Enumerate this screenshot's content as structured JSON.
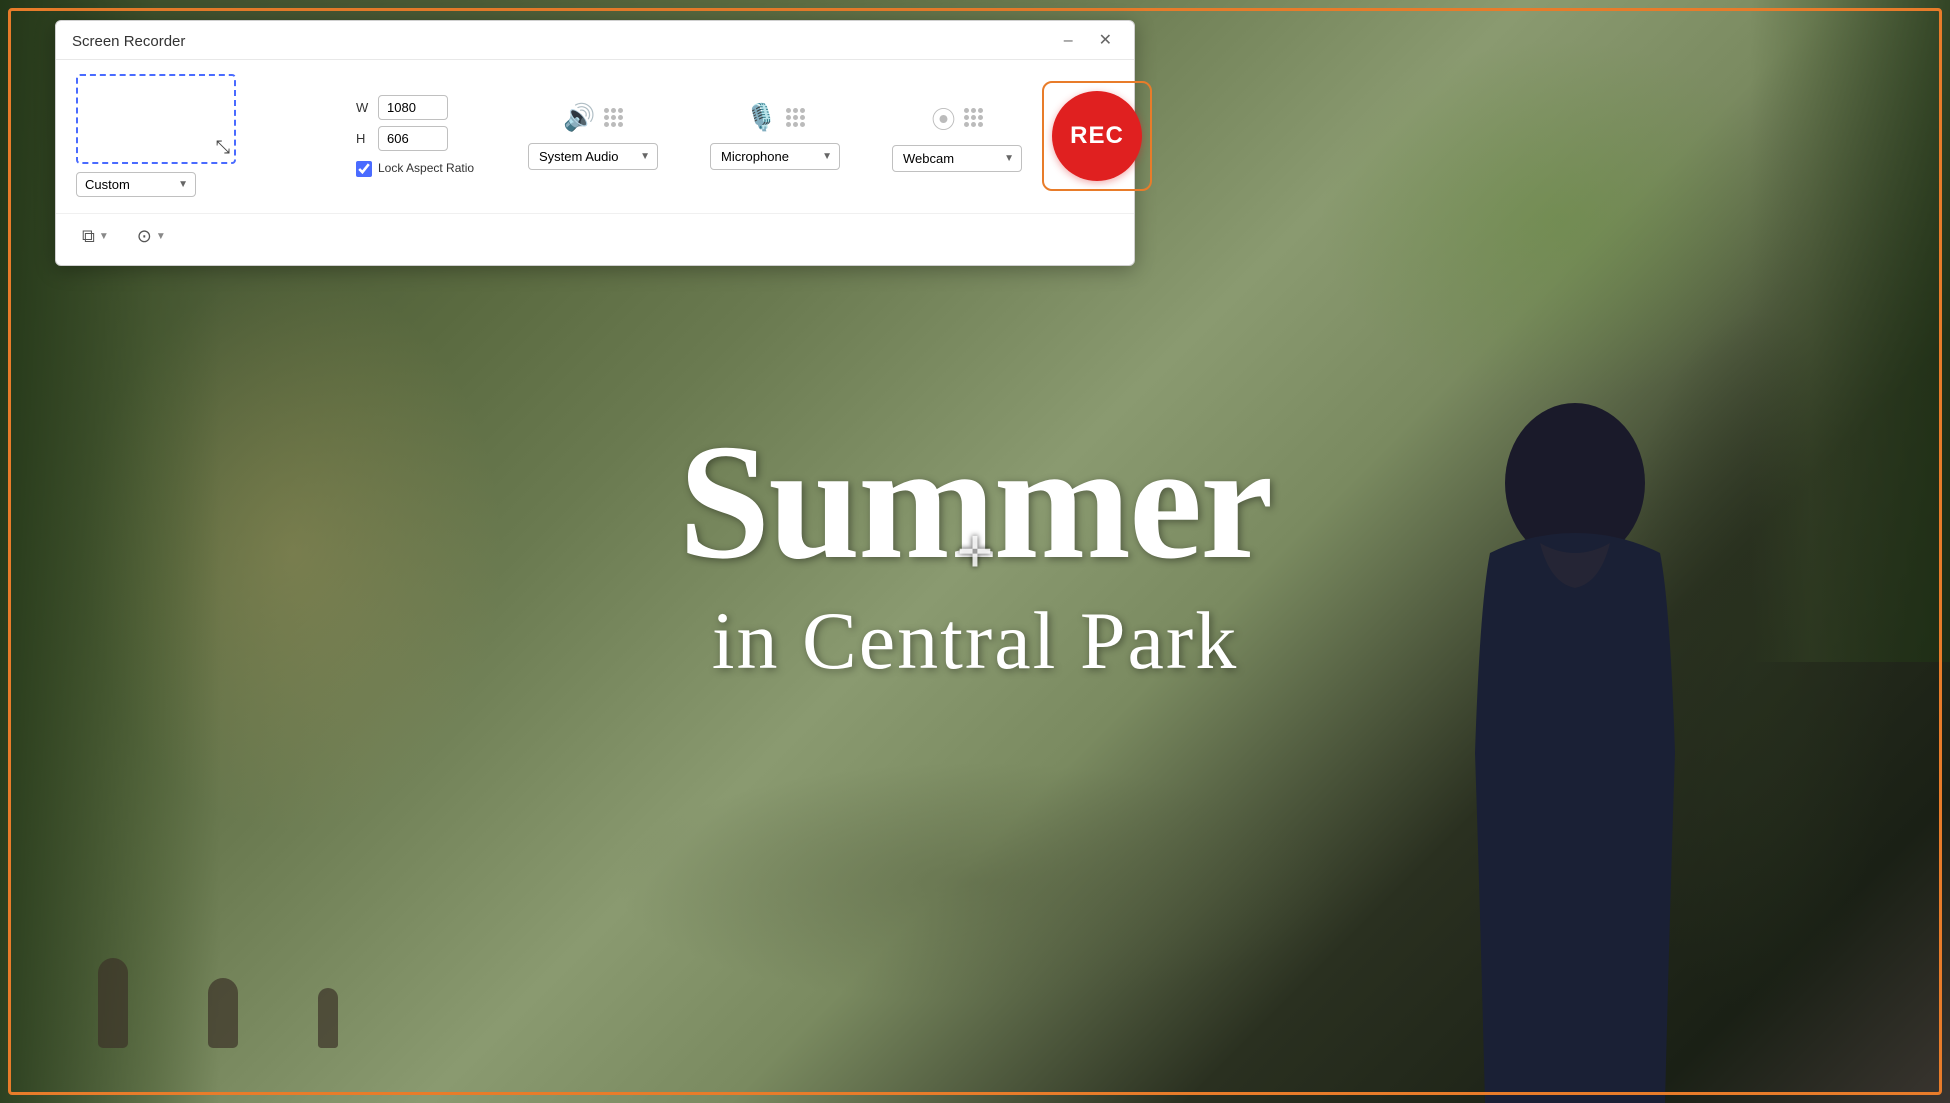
{
  "window": {
    "title": "Screen Recorder",
    "minimize_label": "–",
    "close_label": "✕"
  },
  "region": {
    "dropdown_value": "Custom",
    "width_label": "W",
    "height_label": "H",
    "width_value": "1080",
    "height_value": "606",
    "lock_aspect_label": "Lock Aspect Ratio",
    "lock_checked": true
  },
  "audio": {
    "system_audio_label": "System Audio",
    "microphone_label": "Microphone"
  },
  "webcam": {
    "label": "Webcam"
  },
  "rec_button": {
    "label": "REC"
  },
  "toolbar": {
    "screen_icon": "⧉",
    "settings_icon": "⊙"
  },
  "scene": {
    "title_line1": "Summer",
    "title_line2": "in Central Park"
  }
}
